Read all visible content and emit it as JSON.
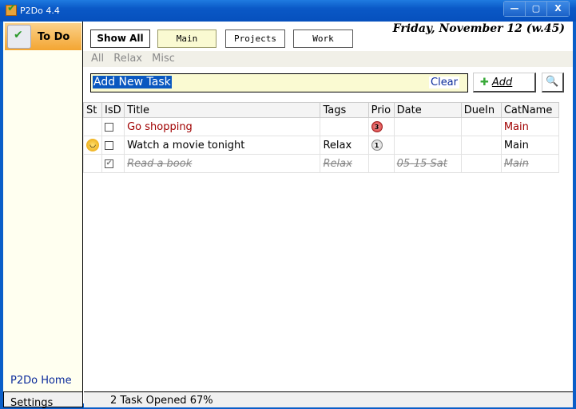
{
  "window": {
    "title": "P2Do 4.4",
    "buttons": [
      "—",
      "▢",
      "X"
    ]
  },
  "sidebar": {
    "todo_label": "To Do",
    "home_label": "P2Do Home",
    "settings_label": "Settings"
  },
  "toolbar": {
    "show_all": "Show All",
    "categories": [
      "Main",
      "Projects",
      "Work"
    ],
    "date": "Friday, November 12 (w.45)"
  },
  "subcategories": [
    "All",
    "Relax",
    "Misc"
  ],
  "new_task": {
    "value": "Add New Task",
    "clear": "Clear",
    "add": "Add",
    "search_icon": "magnifier-icon"
  },
  "table": {
    "columns": [
      "St",
      "IsD",
      "Title",
      "Tags",
      "Prio",
      "Date",
      "DueIn",
      "CatName"
    ],
    "rows": [
      {
        "status": "",
        "done": false,
        "title": "Go shopping",
        "tags": "",
        "prio": "3",
        "date": "",
        "duein": "",
        "cat": "Main",
        "style": "red"
      },
      {
        "status": "smiley",
        "done": true,
        "title": "Watch a movie tonight",
        "tags": "Relax",
        "prio": "1",
        "date": "",
        "duein": "",
        "cat": "Main",
        "style": ""
      },
      {
        "status": "",
        "done": true,
        "title": "Read a book",
        "tags": "Relax",
        "prio": "",
        "date": "05-15 Sat",
        "duein": "",
        "cat": "Main",
        "style": "done"
      }
    ]
  },
  "status": {
    "text": "2  Task Opened 67%"
  },
  "colors": {
    "accent": "#0a58c6",
    "todo": "#f3a532",
    "high_prio": "#a00000"
  }
}
